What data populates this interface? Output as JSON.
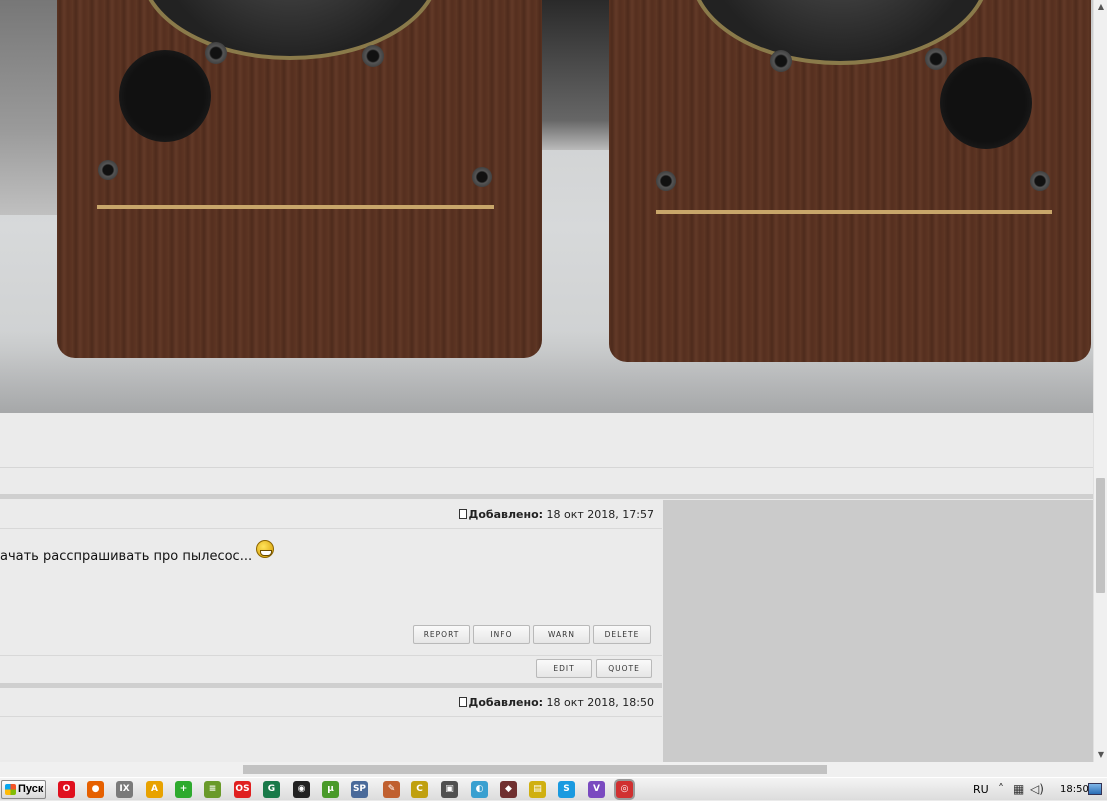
{
  "posts": [
    {
      "date_label": "Добавлено:",
      "date_value": "18 окт 2018, 17:57",
      "text": "ачать расспрашивать про пылесос...",
      "moderation_buttons": [
        "REPORT",
        "INFO",
        "WARN",
        "DELETE"
      ],
      "actions": [
        "EDIT",
        "QUOTE"
      ]
    },
    {
      "date_label": "Добавлено:",
      "date_value": "18 окт 2018, 18:50"
    }
  ],
  "photo": {
    "subject": "pair of wooden loudspeaker cabinets",
    "cabinet_color": "#5a3322",
    "trim_color": "#c8a66a"
  },
  "taskbar": {
    "start_label": "Пуск",
    "language": "RU",
    "clock": "18:50",
    "icons": [
      {
        "name": "opera-icon",
        "glyph": "O",
        "color": "#e0101e"
      },
      {
        "name": "firefox-icon",
        "glyph": "●",
        "color": "#e66000"
      },
      {
        "name": "ie-icon",
        "glyph": "IX",
        "color": "#7a7a7a"
      },
      {
        "name": "avast-icon",
        "glyph": "A",
        "color": "#e8a200"
      },
      {
        "name": "plus-icon",
        "glyph": "+",
        "color": "#2eaa2e"
      },
      {
        "name": "stack-icon",
        "glyph": "≡",
        "color": "#6a9a2a"
      },
      {
        "name": "ok-icon",
        "glyph": "OS",
        "color": "#e02020"
      },
      {
        "name": "app-icon",
        "glyph": "G",
        "color": "#1a7a4a"
      },
      {
        "name": "eye-icon",
        "glyph": "◉",
        "color": "#222222"
      },
      {
        "name": "utorrent-icon",
        "glyph": "μ",
        "color": "#4a9a2a"
      },
      {
        "name": "sp-icon",
        "glyph": "SP",
        "color": "#4a6a9a"
      },
      {
        "name": "paint-icon",
        "glyph": "✎",
        "color": "#c06030"
      },
      {
        "name": "ccleaner-icon",
        "glyph": "C",
        "color": "#c0a010"
      },
      {
        "name": "printer-icon",
        "glyph": "▣",
        "color": "#505050"
      },
      {
        "name": "sync-icon",
        "glyph": "◐",
        "color": "#3aa0d0"
      },
      {
        "name": "diamond-icon",
        "glyph": "◆",
        "color": "#703030"
      },
      {
        "name": "notes-icon",
        "glyph": "▤",
        "color": "#d0b010"
      },
      {
        "name": "skype-icon",
        "glyph": "S",
        "color": "#1a9ae0"
      },
      {
        "name": "viber-icon",
        "glyph": "V",
        "color": "#7a4ac0"
      },
      {
        "name": "chrome-icon",
        "glyph": "◎",
        "color": "#d03030"
      }
    ]
  }
}
